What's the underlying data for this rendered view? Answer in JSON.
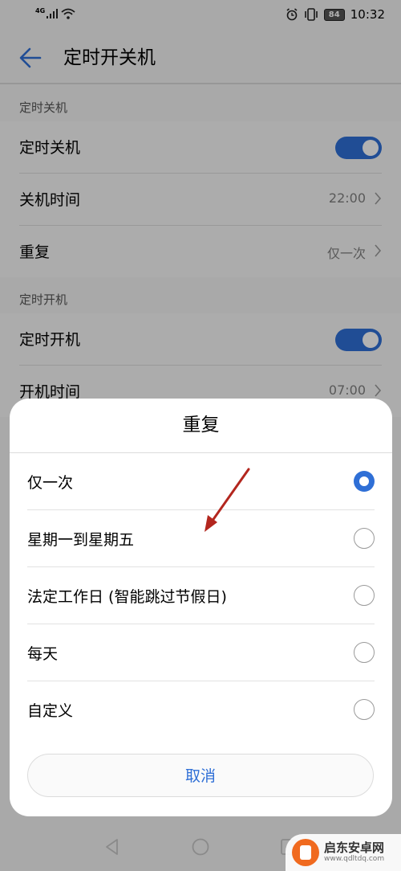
{
  "status_bar": {
    "network": "4G",
    "battery": "84",
    "time": "10:32"
  },
  "header": {
    "title": "定时开关机"
  },
  "shutdown_section": {
    "label": "定时关机",
    "toggle_label": "定时关机",
    "toggle_on": true,
    "time_label": "关机时间",
    "time_value": "22:00",
    "repeat_label": "重复",
    "repeat_value": "仅一次"
  },
  "startup_section": {
    "label": "定时开机",
    "toggle_label": "定时开机",
    "toggle_on": true,
    "time_label": "开机时间",
    "time_value": "07:00"
  },
  "repeat_dialog": {
    "title": "重复",
    "options": [
      {
        "label": "仅一次",
        "selected": true
      },
      {
        "label": "星期一到星期五",
        "selected": false
      },
      {
        "label": "法定工作日 (智能跳过节假日)",
        "selected": false
      },
      {
        "label": "每天",
        "selected": false
      },
      {
        "label": "自定义",
        "selected": false
      }
    ],
    "cancel_label": "取消"
  },
  "watermark": {
    "name": "启东安卓网",
    "url": "www.qdltdq.com"
  },
  "colors": {
    "accent": "#2f6fd6",
    "annotation_arrow": "#b3261e"
  }
}
